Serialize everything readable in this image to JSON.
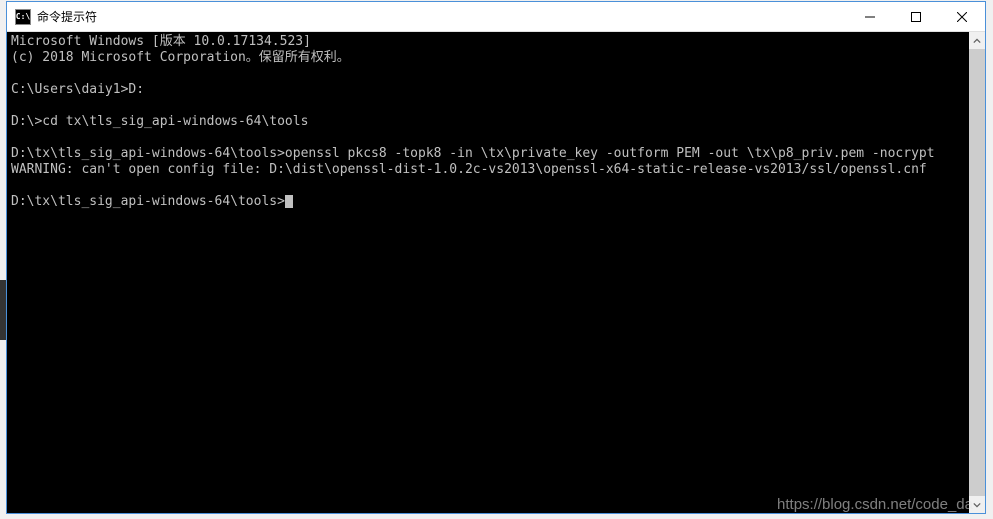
{
  "window": {
    "icon_label": "C:\\",
    "title": "命令提示符"
  },
  "terminal": {
    "lines": [
      "Microsoft Windows [版本 10.0.17134.523]",
      "(c) 2018 Microsoft Corporation。保留所有权利。",
      "",
      "C:\\Users\\daiy1>D:",
      "",
      "D:\\>cd tx\\tls_sig_api-windows-64\\tools",
      "",
      "D:\\tx\\tls_sig_api-windows-64\\tools>openssl pkcs8 -topk8 -in \\tx\\private_key -outform PEM -out \\tx\\p8_priv.pem -nocrypt",
      "WARNING: can't open config file: D:\\dist\\openssl-dist-1.0.2c-vs2013\\openssl-x64-static-release-vs2013/ssl/openssl.cnf",
      "",
      "D:\\tx\\tls_sig_api-windows-64\\tools>"
    ]
  },
  "watermark": "https://blog.csdn.net/code_da"
}
